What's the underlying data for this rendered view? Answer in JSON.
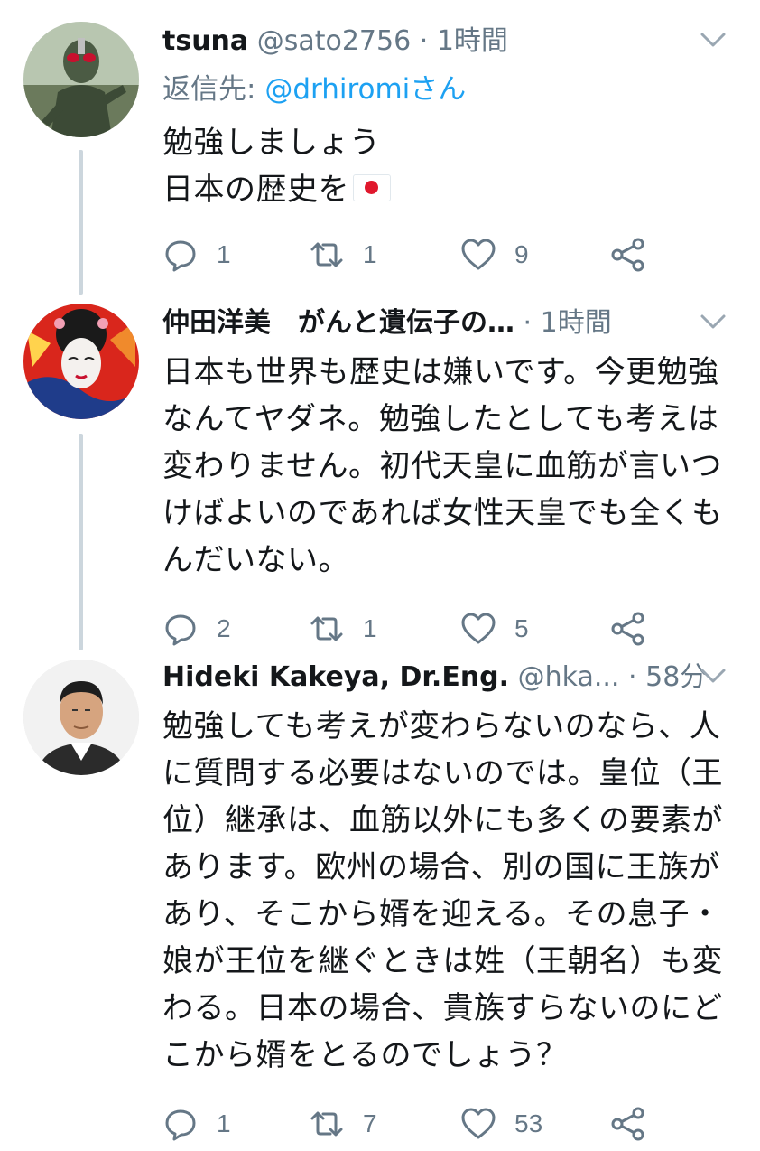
{
  "tweets": [
    {
      "name": "tsuna",
      "handle": "@sato2756",
      "separator": "·",
      "time": "1時間",
      "reply_prefix": "返信先: ",
      "reply_mention": "@drhiromiさん",
      "lines": [
        "勉強しましょう",
        "日本の歴史を"
      ],
      "flag": "japan-flag",
      "replies": "1",
      "retweets": "1",
      "likes": "9"
    },
    {
      "name": "仲田洋美　がんと遺伝子の…",
      "separator": "·",
      "time": "1時間",
      "lines": [
        "日本も世界も歴史は嫌いです。今更勉強",
        "なんてヤダネ。勉強したとしても考えは",
        "変わりません。初代天皇に血筋が言いつ",
        "けばよいのであれば女性天皇でも全くも",
        "んだいない。"
      ],
      "replies": "2",
      "retweets": "1",
      "likes": "5"
    },
    {
      "name": "Hideki Kakeya, Dr.Eng.",
      "handle": "@hka...",
      "separator": "·",
      "time": "58分",
      "lines": [
        "勉強しても考えが変わらないのなら、人",
        "に質問する必要はないのでは。皇位（王",
        "位）継承は、血筋以外にも多くの要素が",
        "あります。欧州の場合、別の国に王族が",
        "あり、そこから婿を迎える。その息子・",
        "娘が王位を継ぐときは姓（王朝名）も変",
        "わる。日本の場合、貴族すらないのにど",
        "こから婿をとるのでしょう？"
      ],
      "replies": "1",
      "retweets": "7",
      "likes": "53"
    }
  ],
  "colors": {
    "text": "#14171a",
    "secondary": "#657786",
    "link": "#1da1f2",
    "thread": "#ccd6dd"
  },
  "icons": [
    "reply-icon",
    "retweet-icon",
    "like-icon",
    "share-icon",
    "chevron-down-icon"
  ]
}
